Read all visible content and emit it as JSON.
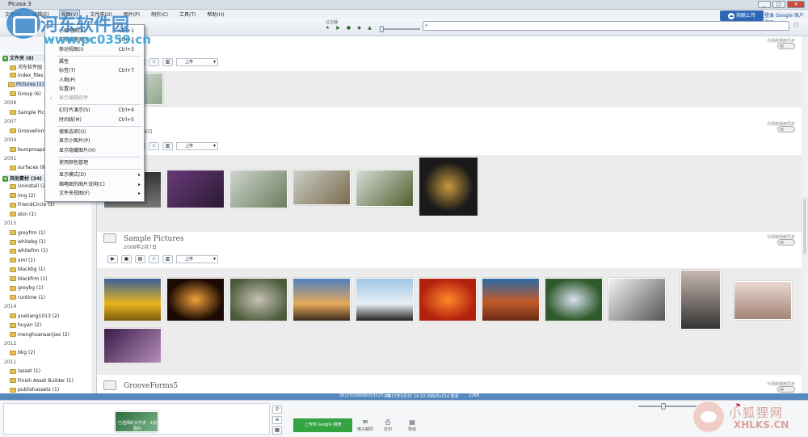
{
  "window": {
    "title": "Picasa 3",
    "controls": [
      "_",
      "□",
      "✕"
    ]
  },
  "menubar": [
    "文件(F)",
    "编辑(E)",
    "视图(V)",
    "文件夹(O)",
    "图片(P)",
    "制作(C)",
    "工具(T)",
    "帮助(H)"
  ],
  "header": {
    "upload_label": "指随上传",
    "google_login": "登录 Google 账户登录",
    "filters_label": "过滤器"
  },
  "view_menu": {
    "items": [
      {
        "label": "小缩略图(A)",
        "shortcut": "Ctrl+1",
        "checked": false
      },
      {
        "label": "正常缩略图(N)",
        "shortcut": "Ctrl+2",
        "checked": true
      },
      {
        "label": "移动视图(I)",
        "shortcut": "Ctrl+3",
        "checked": false
      },
      {
        "label": "属性",
        "shortcut": "",
        "checked": false
      },
      {
        "label": "标签(T)",
        "shortcut": "Ctrl+T",
        "checked": false
      },
      {
        "label": "人物(P)",
        "shortcut": "",
        "checked": false
      },
      {
        "label": "位置(P)",
        "shortcut": "",
        "checked": false
      },
      {
        "label": "显示编辑控件",
        "shortcut": "",
        "checked": true,
        "disabled": true
      },
      {
        "label": "幻灯片演示(S)",
        "shortcut": "Ctrl+4",
        "checked": false
      },
      {
        "label": "时间线(M)",
        "shortcut": "Ctrl+5",
        "checked": false
      },
      {
        "label": "搜索选项(O)",
        "shortcut": "",
        "checked": false
      },
      {
        "label": "显示小图片(P)",
        "shortcut": "",
        "checked": false
      },
      {
        "label": "显示隐藏图片(H)",
        "shortcut": "",
        "checked": false
      },
      {
        "label": "使用颜色管理",
        "shortcut": "",
        "checked": false
      },
      {
        "label": "显示模式(D)",
        "shortcut": "",
        "submenu": true
      },
      {
        "label": "缩略图的图片说明(C)",
        "shortcut": "",
        "submenu": true
      },
      {
        "label": "文件夹视图(F)",
        "shortcut": "",
        "submenu": true
      }
    ]
  },
  "sidebar": {
    "rows": [
      {
        "kind": "header",
        "label": "文件夹 (8)"
      },
      {
        "kind": "item",
        "label": "河东软件园"
      },
      {
        "kind": "item",
        "label": "index_files (2)"
      },
      {
        "kind": "item",
        "label": "Pictures (1)",
        "selected": true
      },
      {
        "kind": "item",
        "label": "Group (6)"
      },
      {
        "kind": "year",
        "label": "2008"
      },
      {
        "kind": "item",
        "label": "Sample Pictures"
      },
      {
        "kind": "year",
        "label": "2007"
      },
      {
        "kind": "item",
        "label": "GrooveForms5"
      },
      {
        "kind": "year",
        "label": "2004"
      },
      {
        "kind": "item",
        "label": "bumpmaps"
      },
      {
        "kind": "year",
        "label": "2001"
      },
      {
        "kind": "item",
        "label": "surfaces (9)"
      },
      {
        "kind": "header",
        "label": "其他素材 (34)"
      },
      {
        "kind": "item",
        "label": "Uninstall (2)"
      },
      {
        "kind": "item",
        "label": "img (2)"
      },
      {
        "kind": "item",
        "label": "FriendCircle (1)"
      },
      {
        "kind": "item",
        "label": "skin (1)"
      },
      {
        "kind": "year",
        "label": "2015"
      },
      {
        "kind": "item",
        "label": "greyfrm (1)"
      },
      {
        "kind": "item",
        "label": "whitebg (1)"
      },
      {
        "kind": "item",
        "label": "whitefrm (1)"
      },
      {
        "kind": "item",
        "label": "xml (1)"
      },
      {
        "kind": "item",
        "label": "blackbg (1)"
      },
      {
        "kind": "item",
        "label": "blackfrm (1)"
      },
      {
        "kind": "item",
        "label": "greybg (1)"
      },
      {
        "kind": "item",
        "label": "runtime (1)"
      },
      {
        "kind": "year",
        "label": "2014"
      },
      {
        "kind": "item",
        "label": "yueliang1013 (2)"
      },
      {
        "kind": "item",
        "label": "huyan (2)"
      },
      {
        "kind": "item",
        "label": "menghuansanjiao (2)"
      },
      {
        "kind": "year",
        "label": "2012"
      },
      {
        "kind": "item",
        "label": "bkg (2)"
      },
      {
        "kind": "year",
        "label": "2011"
      },
      {
        "kind": "item",
        "label": "lasset (1)"
      },
      {
        "kind": "item",
        "label": "Finish Asset Builder (1)"
      },
      {
        "kind": "item",
        "label": "publishassets (1)"
      }
    ]
  },
  "sections": [
    {
      "title": "",
      "date": "",
      "sync": "与网络相册同步"
    },
    {
      "title": "",
      "date": "…月26日",
      "sync": "与网络相册同步"
    },
    {
      "title": "Sample Pictures",
      "date": "2008年2月7日",
      "sync": "与网络相册同步"
    },
    {
      "title": "GrooveForms5",
      "date": "",
      "sync": "与网络相册同步"
    }
  ],
  "action_bar": {
    "upload_select": "上传"
  },
  "status": {
    "filename": "20170326095053223.jpg",
    "datetime": "2017年5月31 14:10:26",
    "dimensions": "605x314 像素",
    "size": "22KB"
  },
  "tray": {
    "caption": "已选择的文件夹 - 1张图片"
  },
  "bottom_actions": {
    "google_upload": "上传到 Google 相册",
    "email": "电子邮件",
    "print": "打印",
    "export": "导出"
  },
  "watermarks": {
    "top_title": "河东软件园",
    "top_url": "www.pc0359.cn",
    "bottom_cn": "小狐狸网",
    "bottom_en": "XHLKS.CN"
  },
  "colors": {
    "status_bar": "#5588bd",
    "google_button": "#34a341",
    "upload_button": "#2d67b5"
  }
}
